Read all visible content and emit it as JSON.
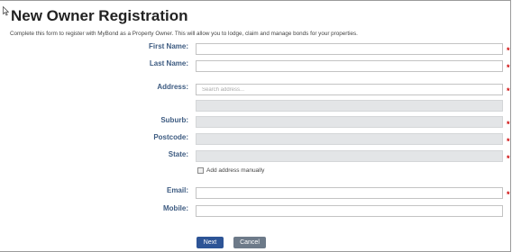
{
  "page": {
    "title": "New Owner Registration",
    "intro": "Complete this form to register with MyBond as a Property Owner. This will allow you to lodge, claim and manage bonds for your properties."
  },
  "form": {
    "first_name": {
      "label": "First Name:",
      "value": ""
    },
    "last_name": {
      "label": "Last Name:",
      "value": ""
    },
    "address": {
      "label": "Address:",
      "placeholder": "Search address...",
      "value": ""
    },
    "suburb": {
      "label": "Suburb:",
      "value": ""
    },
    "postcode": {
      "label": "Postcode:",
      "value": ""
    },
    "state": {
      "label": "State:",
      "value": ""
    },
    "manual_address_label": "Add address manually",
    "email": {
      "label": "Email:",
      "value": ""
    },
    "mobile": {
      "label": "Mobile:",
      "value": ""
    },
    "required_marker": "*"
  },
  "actions": {
    "next_label": "Next",
    "cancel_label": "Cancel"
  },
  "colors": {
    "label": "#3d5b81",
    "required": "#cc0000",
    "next_button": "#2d5496",
    "cancel_button": "#6d7a89",
    "disabled_field": "#e3e5e7"
  }
}
